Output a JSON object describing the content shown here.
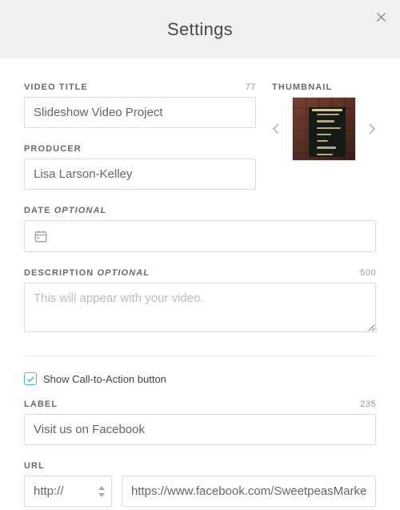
{
  "header": {
    "title": "Settings"
  },
  "videoTitle": {
    "label": "VIDEO TITLE",
    "value": "Slideshow Video Project",
    "counter": "77"
  },
  "producer": {
    "label": "PRODUCER",
    "value": "Lisa Larson-Kelley"
  },
  "date": {
    "label": "DATE",
    "optional": "OPTIONAL",
    "value": ""
  },
  "description": {
    "label": "DESCRIPTION",
    "optional": "OPTIONAL",
    "placeholder": "This will appear with your video.",
    "value": "",
    "counter": "500"
  },
  "thumbnail": {
    "label": "THUMBNAIL"
  },
  "cta": {
    "checkboxLabel": "Show Call-to-Action button",
    "checked": true,
    "label": {
      "label": "LABEL",
      "value": "Visit us on Facebook",
      "counter": "235"
    },
    "url": {
      "label": "URL",
      "protocol": "http://",
      "value": "https://www.facebook.com/SweetpeasMarket"
    }
  }
}
